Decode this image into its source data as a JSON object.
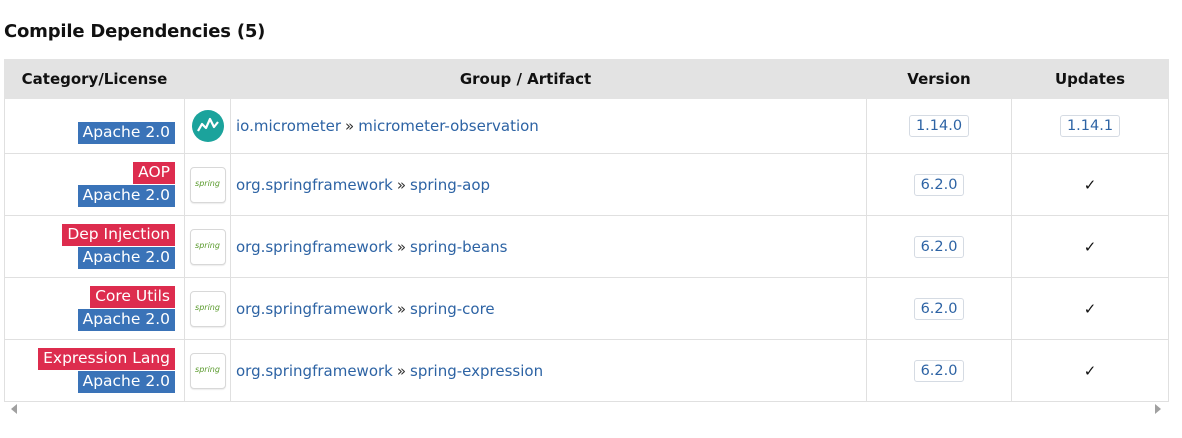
{
  "section": {
    "title": "Compile Dependencies (5)"
  },
  "table": {
    "headers": {
      "category": "Category/License",
      "group_artifact": "Group / Artifact",
      "version": "Version",
      "updates": "Updates"
    },
    "rows": [
      {
        "category": "",
        "license": "Apache 2.0",
        "icon": "micrometer-icon",
        "group": "io.micrometer",
        "separator": "»",
        "artifact": "micrometer-observation",
        "version": "1.14.0",
        "update": "1.14.1"
      },
      {
        "category": "AOP",
        "license": "Apache 2.0",
        "icon": "spring-icon",
        "icon_text": "spring",
        "group": "org.springframework",
        "separator": "»",
        "artifact": "spring-aop",
        "version": "6.2.0",
        "update": "✓"
      },
      {
        "category": "Dep Injection",
        "license": "Apache 2.0",
        "icon": "spring-icon",
        "icon_text": "spring",
        "group": "org.springframework",
        "separator": "»",
        "artifact": "spring-beans",
        "version": "6.2.0",
        "update": "✓"
      },
      {
        "category": "Core Utils",
        "license": "Apache 2.0",
        "icon": "spring-icon",
        "icon_text": "spring",
        "group": "org.springframework",
        "separator": "»",
        "artifact": "spring-core",
        "version": "6.2.0",
        "update": "✓"
      },
      {
        "category": "Expression Lang",
        "license": "Apache 2.0",
        "icon": "spring-icon",
        "icon_text": "spring",
        "group": "org.springframework",
        "separator": "»",
        "artifact": "spring-expression",
        "version": "6.2.0",
        "update": "✓"
      }
    ]
  },
  "colors": {
    "header_bg": "#e3e3e3",
    "category_label": "#dd2c4e",
    "license_label": "#3a73b8",
    "link": "#2d63a4",
    "micrometer_teal": "#1ba39c",
    "spring_green": "#5b9b2e"
  }
}
